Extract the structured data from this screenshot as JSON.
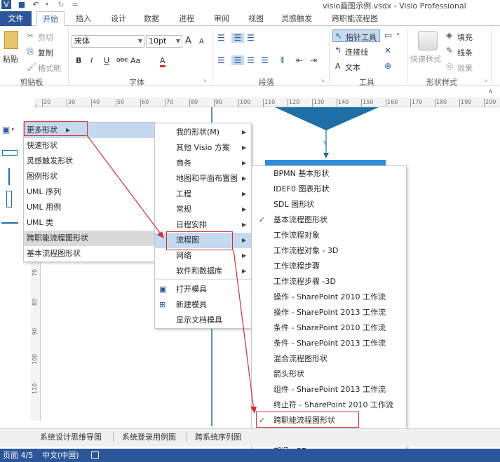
{
  "titlebar": {
    "title": "visio画图示例.vsdx - Visio Professional"
  },
  "tabs": [
    "文件",
    "开始",
    "插入",
    "设计",
    "数据",
    "进程",
    "审阅",
    "视图",
    "灵感触发",
    "跨职能流程图"
  ],
  "clipboard": {
    "paste": "粘贴",
    "cut": "剪切",
    "copy": "复制",
    "format_painter": "格式刷",
    "group": "剪贴板"
  },
  "font": {
    "name": "宋体",
    "size": "10pt",
    "group": "字体",
    "bold": "B",
    "italic": "I",
    "underline": "U",
    "strike": "abc",
    "case": "Aa",
    "color": "A",
    "grow": "A",
    "shrink": "A"
  },
  "paragraph": {
    "group": "段落"
  },
  "tools": {
    "pointer": "指针工具",
    "connector": "连接线",
    "text": "文本",
    "group": "工具"
  },
  "shape_styles": {
    "quick_styles": "快速样式",
    "fill": "填充",
    "line": "线条",
    "effects": "效果",
    "group": "形状样式"
  },
  "ruler_ticks": [
    "20",
    "30",
    "40",
    "50",
    "60",
    "70",
    "80",
    "90",
    "100",
    "110",
    "120",
    "130",
    "140",
    "150",
    "160",
    "170",
    "180",
    "190",
    "200"
  ],
  "vruler_ticks": [
    "60",
    "70",
    "80",
    "90",
    "100",
    "110"
  ],
  "menu1": [
    "更多形状",
    "快速形状",
    "灵感触发形状",
    "图例形状",
    "UML 序列",
    "UML 用例",
    "UML 类",
    "跨职能流程图形状",
    "基本流程图形状"
  ],
  "menu2": [
    "我的形状(M)",
    "其他 Visio 方案",
    "商务",
    "地图和平面布置图",
    "工程",
    "常规",
    "日程安排",
    "流程图",
    "网络",
    "软件和数据库",
    "打开模具",
    "新建模具",
    "显示文档模具"
  ],
  "menu3": [
    "BPMN 基本形状",
    "IDEF0 图表形状",
    "SDL 图形状",
    "基本流程图形状",
    "工作流程对象",
    "工作流程对象 - 3D",
    "工作流程步骤",
    "工作流程步骤 -3D",
    "操作 - SharePoint 2010 工作流",
    "操作 - SharePoint 2013 工作流",
    "条件 - SharePoint 2010 工作流",
    "条件 - SharePoint 2013 工作流",
    "混合流程图形状",
    "箭头形状",
    "组件 - SharePoint 2013 工作流",
    "终止符 - SharePoint 2010 工作流",
    "跨职能流程图形状",
    "部门",
    "部门 - 3D"
  ],
  "canvas_shape_text": "Y",
  "sheet_tabs": [
    "系统设计思维导图",
    "系统登录用例图",
    "跨系统序列图"
  ],
  "status": {
    "page": "页面 4/5",
    "language": "中文(中国)"
  },
  "colors": {
    "accent": "#2b579a",
    "highlight": "#c5d9f1",
    "annotation": "#d32f2f",
    "shape": "#1e6fa8"
  }
}
